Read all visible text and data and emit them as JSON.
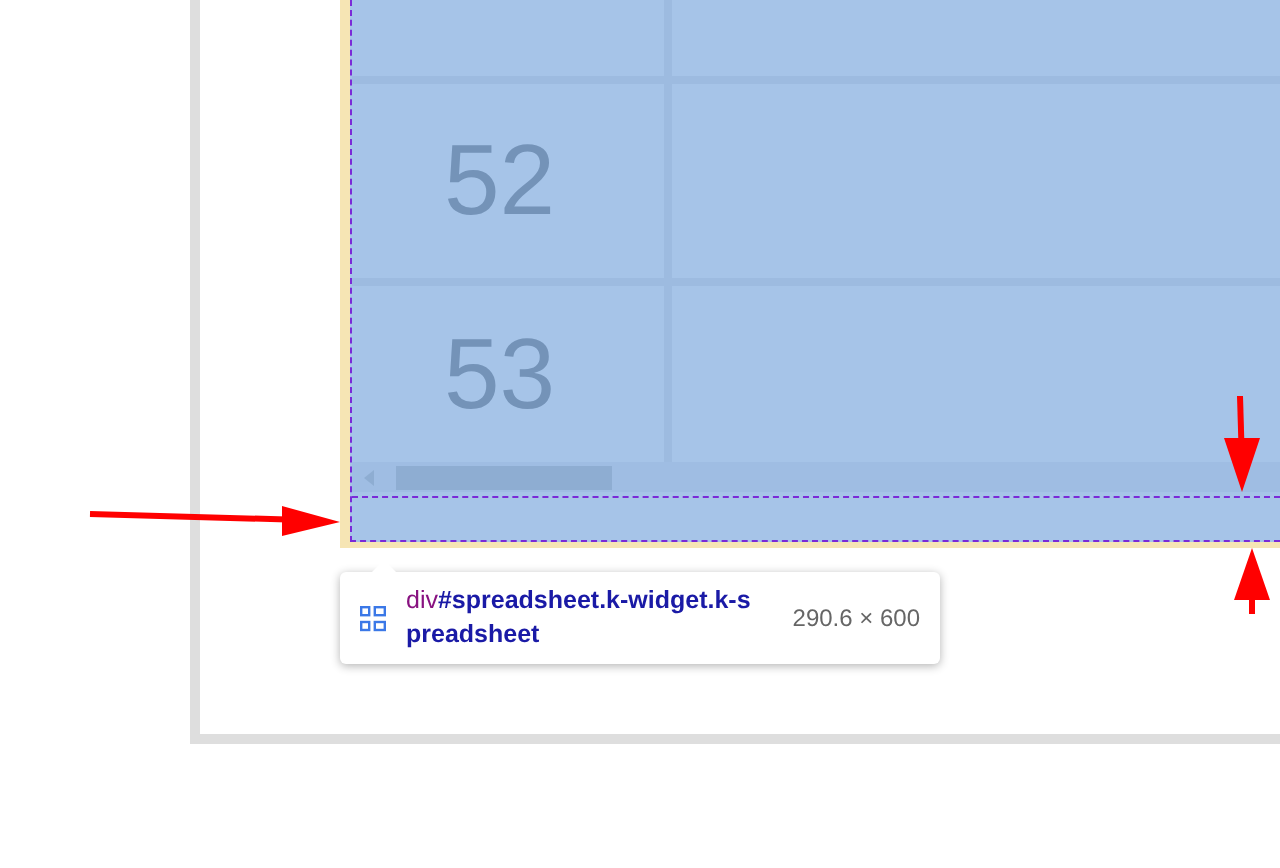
{
  "spreadsheet": {
    "rows": [
      {
        "label": "52"
      },
      {
        "label": "53"
      }
    ]
  },
  "tooltip": {
    "tag": "div",
    "selector": "#spreadsheet.k-widget.k-spreadsheet",
    "size": "290.6 × 600"
  }
}
